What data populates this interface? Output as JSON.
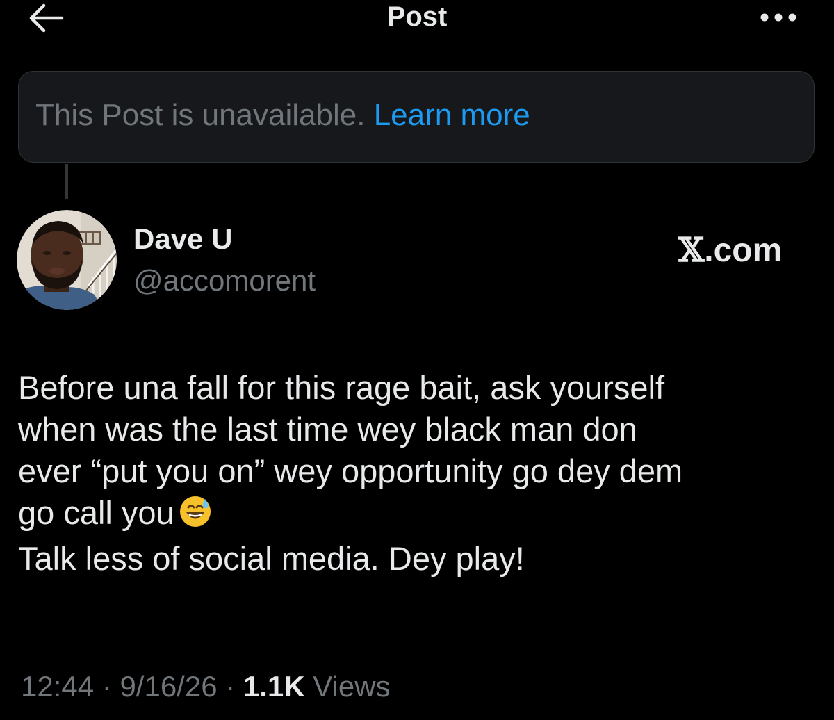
{
  "header": {
    "back_icon": "arrow-left-icon",
    "title": "Post",
    "more_icon": "more-horizontal-icon"
  },
  "notice": {
    "text": "This Post is unavailable.",
    "link_label": "Learn more"
  },
  "author": {
    "name": "Dave U",
    "handle": "@accomorent",
    "avatar_icon": "profile-photo-avatar"
  },
  "badge": {
    "x_mark": "𝕏",
    "domain_suffix": ".com"
  },
  "post": {
    "lines": [
      "Before una fall for this rage bait, ask yourself",
      "when was the last time wey black man don",
      "ever “put you on” wey opportunity go dey dem",
      "go call you",
      "Talk less of social media. Dey play!"
    ],
    "emoji_icon": "grinning-face-with-sweat-emoji"
  },
  "meta": {
    "time": "12:44",
    "sep1": " · ",
    "date": "9/16/26",
    "sep2": " · ",
    "views_count": "1.1K",
    "views_label": " Views"
  },
  "colors": {
    "background": "#000000",
    "text_primary": "#e7e9ea",
    "text_secondary": "#71767b",
    "link": "#1d9bf0",
    "notice_bg": "#16181c",
    "border": "#2f3336"
  }
}
